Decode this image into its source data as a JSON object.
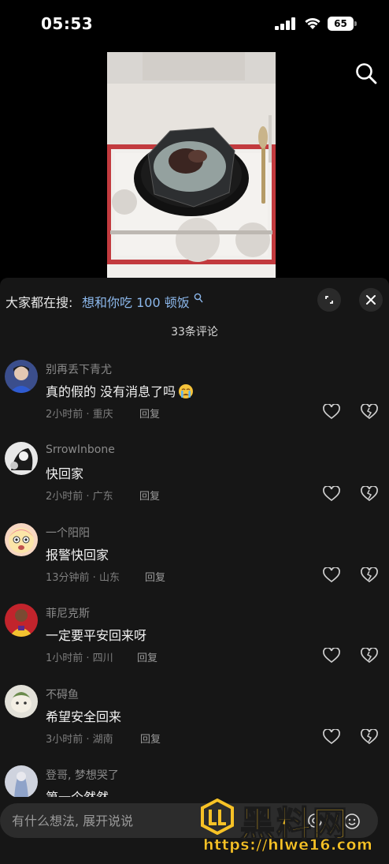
{
  "status_bar": {
    "time": "05:53",
    "battery": "65"
  },
  "panel": {
    "trending_label": "大家都在搜:",
    "trending_query": "想和你吃 100 顿饭",
    "comment_count": "33条评论"
  },
  "comments": [
    {
      "user": "别再丢下青尤",
      "text": "真的假的  没有消息了吗",
      "emoji": "crying-face",
      "meta": "2小时前 · 重庆",
      "reply": "回复"
    },
    {
      "user": "SrrowInbone",
      "text": "快回家",
      "meta": "2小时前 · 广东",
      "reply": "回复"
    },
    {
      "user": "一个阳阳",
      "text": "报警快回家",
      "meta": "13分钟前 · 山东",
      "reply": "回复"
    },
    {
      "user": "菲尼克斯",
      "text": "一定要平安回来呀",
      "meta": "1小时前 · 四川",
      "reply": "回复"
    },
    {
      "user": "不碍鱼",
      "text": "希望安全回来",
      "meta": "3小时前 · 湖南",
      "reply": "回复"
    },
    {
      "user": "登哥, 梦想哭了",
      "text": "第一个然然"
    }
  ],
  "input": {
    "placeholder": "有什么想法, 展开说说"
  },
  "watermark": {
    "brand": "黑料网",
    "url": "https://hlwe16.com"
  },
  "colors": {
    "accent_link": "#8cb8ec",
    "panel_bg": "#161616",
    "watermark": "#f7c226"
  }
}
